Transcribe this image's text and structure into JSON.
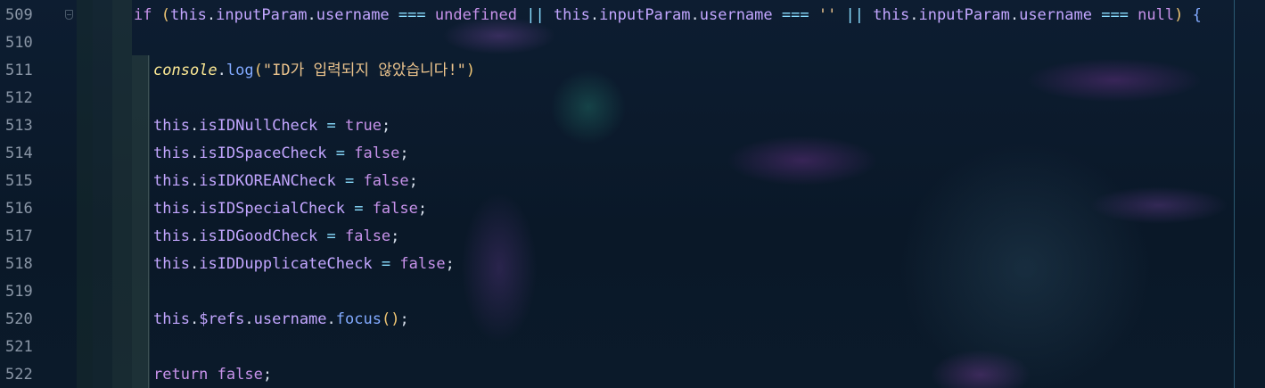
{
  "editor": {
    "lines": [
      {
        "number": "509",
        "indent": 0,
        "tokens": [
          {
            "t": "if ",
            "c": "kw"
          },
          {
            "t": "(",
            "c": "paren"
          },
          {
            "t": "this",
            "c": "this"
          },
          {
            "t": ".",
            "c": "punc"
          },
          {
            "t": "inputParam",
            "c": "prop"
          },
          {
            "t": ".",
            "c": "punc"
          },
          {
            "t": "username",
            "c": "prop"
          },
          {
            "t": " === ",
            "c": "op"
          },
          {
            "t": "undefined",
            "c": "undef"
          },
          {
            "t": " || ",
            "c": "op"
          },
          {
            "t": "this",
            "c": "this"
          },
          {
            "t": ".",
            "c": "punc"
          },
          {
            "t": "inputParam",
            "c": "prop"
          },
          {
            "t": ".",
            "c": "punc"
          },
          {
            "t": "username",
            "c": "prop"
          },
          {
            "t": " === ",
            "c": "op"
          },
          {
            "t": "''",
            "c": "str"
          },
          {
            "t": " || ",
            "c": "op"
          },
          {
            "t": "this",
            "c": "this"
          },
          {
            "t": ".",
            "c": "punc"
          },
          {
            "t": "inputParam",
            "c": "prop"
          },
          {
            "t": ".",
            "c": "punc"
          },
          {
            "t": "username",
            "c": "prop"
          },
          {
            "t": " === ",
            "c": "op"
          },
          {
            "t": "null",
            "c": "nul"
          },
          {
            "t": ")",
            "c": "paren"
          },
          {
            "t": " {",
            "c": "brace"
          }
        ]
      },
      {
        "number": "510",
        "indent": 1,
        "tokens": []
      },
      {
        "number": "511",
        "indent": 1,
        "tokens": [
          {
            "t": "console",
            "c": "obj"
          },
          {
            "t": ".",
            "c": "punc"
          },
          {
            "t": "log",
            "c": "method"
          },
          {
            "t": "(",
            "c": "paren"
          },
          {
            "t": "\"ID가 입력되지 않았습니다!\"",
            "c": "str"
          },
          {
            "t": ")",
            "c": "paren"
          }
        ]
      },
      {
        "number": "512",
        "indent": 1,
        "tokens": []
      },
      {
        "number": "513",
        "indent": 1,
        "tokens": [
          {
            "t": "this",
            "c": "this"
          },
          {
            "t": ".",
            "c": "punc"
          },
          {
            "t": "isIDNullCheck",
            "c": "prop"
          },
          {
            "t": " = ",
            "c": "op"
          },
          {
            "t": "true",
            "c": "bool"
          },
          {
            "t": ";",
            "c": "punc"
          }
        ]
      },
      {
        "number": "514",
        "indent": 1,
        "tokens": [
          {
            "t": "this",
            "c": "this"
          },
          {
            "t": ".",
            "c": "punc"
          },
          {
            "t": "isIDSpaceCheck",
            "c": "prop"
          },
          {
            "t": " = ",
            "c": "op"
          },
          {
            "t": "false",
            "c": "bool"
          },
          {
            "t": ";",
            "c": "punc"
          }
        ]
      },
      {
        "number": "515",
        "indent": 1,
        "tokens": [
          {
            "t": "this",
            "c": "this"
          },
          {
            "t": ".",
            "c": "punc"
          },
          {
            "t": "isIDKOREANCheck",
            "c": "prop"
          },
          {
            "t": " = ",
            "c": "op"
          },
          {
            "t": "false",
            "c": "bool"
          },
          {
            "t": ";",
            "c": "punc"
          }
        ]
      },
      {
        "number": "516",
        "indent": 1,
        "tokens": [
          {
            "t": "this",
            "c": "this"
          },
          {
            "t": ".",
            "c": "punc"
          },
          {
            "t": "isIDSpecialCheck",
            "c": "prop"
          },
          {
            "t": " = ",
            "c": "op"
          },
          {
            "t": "false",
            "c": "bool"
          },
          {
            "t": ";",
            "c": "punc"
          }
        ]
      },
      {
        "number": "517",
        "indent": 1,
        "tokens": [
          {
            "t": "this",
            "c": "this"
          },
          {
            "t": ".",
            "c": "punc"
          },
          {
            "t": "isIDGoodCheck",
            "c": "prop"
          },
          {
            "t": " = ",
            "c": "op"
          },
          {
            "t": "false",
            "c": "bool"
          },
          {
            "t": ";",
            "c": "punc"
          }
        ]
      },
      {
        "number": "518",
        "indent": 1,
        "tokens": [
          {
            "t": "this",
            "c": "this"
          },
          {
            "t": ".",
            "c": "punc"
          },
          {
            "t": "isIDDupplicateCheck",
            "c": "prop"
          },
          {
            "t": " = ",
            "c": "op"
          },
          {
            "t": "false",
            "c": "bool"
          },
          {
            "t": ";",
            "c": "punc"
          }
        ]
      },
      {
        "number": "519",
        "indent": 1,
        "tokens": []
      },
      {
        "number": "520",
        "indent": 1,
        "tokens": [
          {
            "t": "this",
            "c": "this"
          },
          {
            "t": ".",
            "c": "punc"
          },
          {
            "t": "$refs",
            "c": "dollar"
          },
          {
            "t": ".",
            "c": "punc"
          },
          {
            "t": "username",
            "c": "prop"
          },
          {
            "t": ".",
            "c": "punc"
          },
          {
            "t": "focus",
            "c": "method"
          },
          {
            "t": "()",
            "c": "paren"
          },
          {
            "t": ";",
            "c": "punc"
          }
        ]
      },
      {
        "number": "521",
        "indent": 1,
        "tokens": []
      },
      {
        "number": "522",
        "indent": 1,
        "tokens": [
          {
            "t": "return ",
            "c": "ctl"
          },
          {
            "t": "false",
            "c": "bool"
          },
          {
            "t": ";",
            "c": "punc"
          }
        ]
      }
    ]
  }
}
